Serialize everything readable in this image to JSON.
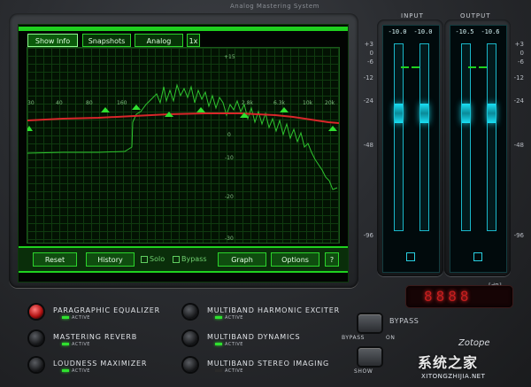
{
  "app": {
    "title": "Analog Mastering System"
  },
  "toolbar": {
    "show_info": "Show Info",
    "snapshots": "Snapshots",
    "analog": "Analog",
    "zoom": "1x"
  },
  "plot": {
    "freq_labels": [
      "30",
      "40",
      "80",
      "160",
      "2.8k",
      "6.3k",
      "10k",
      "20k"
    ],
    "db_labels": [
      "+15",
      "0",
      "-10",
      "-20",
      "-30"
    ],
    "eq_nodes": 8
  },
  "bottom_bar": {
    "reset": "Reset",
    "history": "History",
    "solo": "Solo",
    "bypass": "Bypass",
    "graph": "Graph",
    "options": "Options",
    "help": "?"
  },
  "meters": {
    "input": {
      "title": "INPUT",
      "peak_left": "-10.0",
      "peak_right": "-10.0"
    },
    "output": {
      "title": "OUTPUT",
      "peak_left": "-10.5",
      "peak_right": "-10.6"
    },
    "scale": [
      "+3",
      "0",
      "-6",
      "-12",
      "-24",
      "-48",
      "-96"
    ],
    "unit": "[dB]"
  },
  "led_display": {
    "digits": "8888"
  },
  "modules_left": [
    {
      "label": "PARAGRAPHIC EQUALIZER",
      "status": "ACTIVE",
      "on": true
    },
    {
      "label": "MASTERING REVERB",
      "status": "ACTIVE",
      "on": false
    },
    {
      "label": "LOUDNESS MAXIMIZER",
      "status": "ACTIVE",
      "on": false
    }
  ],
  "modules_right": [
    {
      "label": "MULTIBAND HARMONIC EXCITER",
      "status": "ACTIVE",
      "on": false
    },
    {
      "label": "MULTIBAND DYNAMICS",
      "status": "ACTIVE",
      "on": false
    },
    {
      "label": "MULTIBAND STEREO IMAGING",
      "status": "ACTIVE",
      "on": false
    }
  ],
  "bypass_control": {
    "label": "BYPASS",
    "sub_left": "BYPASS",
    "sub_right": "ON"
  },
  "show_control": {
    "label": "SHOW"
  },
  "brand": {
    "name": "Zotope"
  },
  "watermark": {
    "text": "系统之家",
    "url": "XITONGZHIJIA.NET"
  },
  "colors": {
    "screen_green": "#1fd11f",
    "eq_curve": "#d9262a",
    "meter_cyan": "#1ae0f5",
    "led_red": "#c61e1e"
  }
}
